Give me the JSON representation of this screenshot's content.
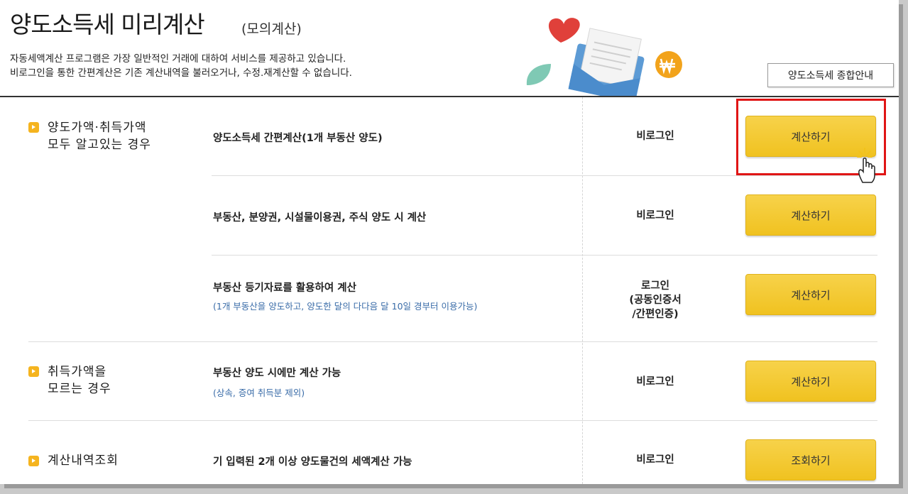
{
  "header": {
    "title": "양도소득세 미리계산",
    "subtitle": "(모의계산)",
    "desc_line1": "자동세액계산 프로그램은 가장 일반적인 거래에 대하여 서비스를 제공하고 있습니다.",
    "desc_line2": "비로그인을 통한 간편계산은 기존 계산내역을 불러오거나, 수정.재계산할 수 없습니다.",
    "guide_button": "양도소득세 종합안내"
  },
  "categories": [
    {
      "line1": "양도가액·취득가액",
      "line2": "모두 알고있는 경우"
    },
    {
      "line1": "취득가액을",
      "line2": "모르는 경우"
    },
    {
      "line1": "계산내역조회",
      "line2": ""
    }
  ],
  "rows": [
    {
      "title": "양도소득세 간편계산(1개 부동산 양도)",
      "note": "",
      "login": "비로그인",
      "button": "계산하기"
    },
    {
      "title": "부동산, 분양권, 시설물이용권, 주식 양도 시 계산",
      "note": "",
      "login": "비로그인",
      "button": "계산하기"
    },
    {
      "title": "부동산 등기자료를 활용하여 계산",
      "note": "(1개 부동산을 양도하고, 양도한 달의 다다음 달 10일 경부터 이용가능)",
      "login_line1": "로그인",
      "login_line2": "(공동인증서",
      "login_line3": "/간편인증)",
      "button": "계산하기"
    },
    {
      "title": "부동산 양도 시에만 계산 가능",
      "note": "(상속, 증여 취득분 제외)",
      "login": "비로그인",
      "button": "계산하기"
    },
    {
      "title": "기 입력된 2개 이상 양도물건의 세액계산 가능",
      "note": "",
      "login": "비로그인",
      "button": "조회하기"
    }
  ],
  "colors": {
    "accent": "#f0c220",
    "highlight": "#e01515",
    "note": "#3a6ca8",
    "bullet": "#f5b41f"
  }
}
